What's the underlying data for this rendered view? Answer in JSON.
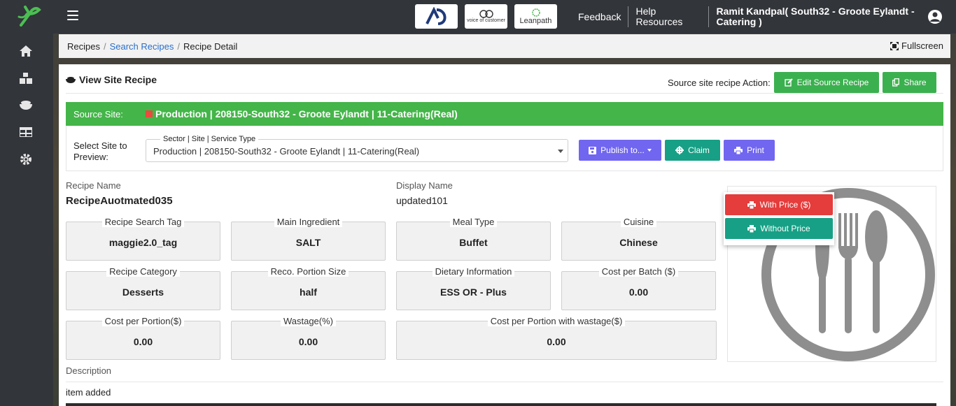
{
  "header": {
    "brands": [
      "AD",
      "voice of customer",
      "Leanpath"
    ],
    "feedback": "Feedback",
    "help": "Help Resources",
    "user": "Ramit Kandpal( South32 - Groote Eylandt - Catering )"
  },
  "sidebar": {
    "icons": [
      "home-icon",
      "boxes-icon",
      "bowl-icon",
      "table-icon",
      "gear-icon"
    ]
  },
  "breadcrumb": {
    "items": [
      "Recipes",
      "Search Recipes",
      "Recipe Detail"
    ],
    "fullscreen": "Fullscreen"
  },
  "card": {
    "title": "View Site Recipe",
    "action_label": "Source site recipe Action:",
    "edit_button": "Edit Source Recipe",
    "share_button": "Share"
  },
  "source": {
    "label": "Source Site:",
    "value": "Production | 208150-South32 - Groote Eylandt | 11-Catering(Real)"
  },
  "preview": {
    "label_line1": "Select Site to",
    "label_line2": "Preview:",
    "select_legend": "Sector | Site | Service Type",
    "select_value": "Production | 208150-South32 - Groote Eylandt | 11-Catering(Real)",
    "publish_button": "Publish to...",
    "claim_button": "Claim",
    "print_button": "Print"
  },
  "print_menu": {
    "with_price": "With Price ($)",
    "without_price": "Without Price"
  },
  "recipe": {
    "name_label": "Recipe Name",
    "name": "RecipeAuotmated035",
    "display_label": "Display Name",
    "display": "updated101"
  },
  "tiles": [
    {
      "label": "Recipe Search Tag",
      "value": "maggie2.0_tag"
    },
    {
      "label": "Main Ingredient",
      "value": "SALT"
    },
    {
      "label": "Meal Type",
      "value": "Buffet"
    },
    {
      "label": "Cuisine",
      "value": "Chinese"
    },
    {
      "label": "Recipe Category",
      "value": "Desserts"
    },
    {
      "label": "Reco. Portion Size",
      "value": "half"
    },
    {
      "label": "Dietary Information",
      "value": "ESS OR - Plus"
    },
    {
      "label": "Cost per Batch ($)",
      "value": "0.00"
    },
    {
      "label": "Cost per Portion($)",
      "value": "0.00"
    },
    {
      "label": "Wastage(%)",
      "value": "0.00"
    },
    {
      "label": "Cost per Portion with wastage($)",
      "value": "0.00"
    }
  ],
  "description": {
    "label": "Description",
    "value": "item added"
  },
  "colors": {
    "green": "#3bb04f",
    "teal": "#17a085",
    "purple": "#7166f0",
    "red": "#e53c3c",
    "link": "#2a6fc9"
  }
}
